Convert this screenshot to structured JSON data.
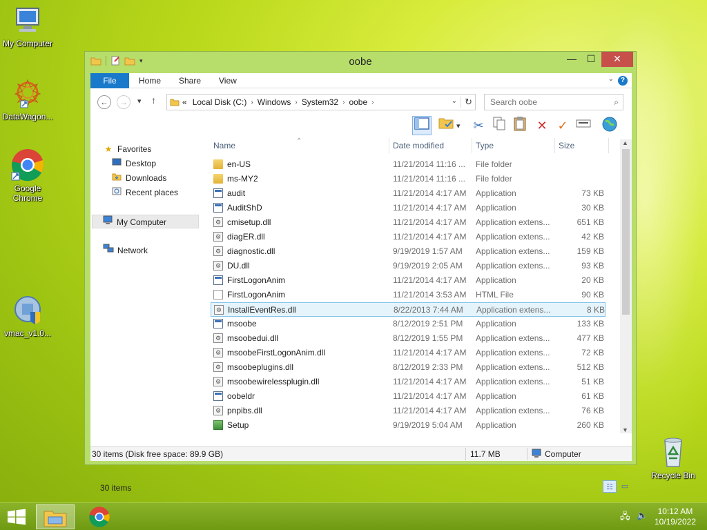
{
  "desktop": {
    "icons": [
      {
        "label": "My Computer",
        "icon": "computer-icon"
      },
      {
        "label": "DataWagon...",
        "icon": "datawagon-shortcut-icon"
      },
      {
        "label": "Google Chrome",
        "icon": "chrome-shortcut-icon"
      },
      {
        "label": "vmac_v1.0...",
        "icon": "vmac-shield-icon"
      },
      {
        "label": "Recycle Bin",
        "icon": "recycle-bin-icon"
      }
    ]
  },
  "window": {
    "title": "oobe",
    "controls": {
      "minimize": "—",
      "maximize": "☐",
      "close": "✕"
    },
    "ribbon_tabs": [
      "File",
      "Home",
      "Share",
      "View"
    ],
    "help": "?",
    "address": {
      "overflow": "«",
      "crumbs": [
        "Local Disk (C:)",
        "Windows",
        "System32",
        "oobe"
      ]
    },
    "search": {
      "placeholder": "Search oobe"
    },
    "toolbar_icons": [
      "details-pane-icon",
      "properties-folder-icon",
      "cut-icon",
      "copy-icon",
      "paste-icon",
      "delete-icon",
      "rename-icon",
      "select-icon",
      "globe-icon"
    ],
    "nav": {
      "favorites": "Favorites",
      "desktop": "Desktop",
      "downloads": "Downloads",
      "recent": "Recent places",
      "computer": "My Computer",
      "network": "Network"
    },
    "columns": {
      "name": "Name",
      "date": "Date modified",
      "type": "Type",
      "size": "Size"
    },
    "files": [
      {
        "name": "en-US",
        "date": "11/21/2014 11:16 ...",
        "type": "File folder",
        "size": "",
        "kind": "folder"
      },
      {
        "name": "ms-MY2",
        "date": "11/21/2014 11:16 ...",
        "type": "File folder",
        "size": "",
        "kind": "folder"
      },
      {
        "name": "audit",
        "date": "11/21/2014 4:17 AM",
        "type": "Application",
        "size": "73 KB",
        "kind": "app"
      },
      {
        "name": "AuditShD",
        "date": "11/21/2014 4:17 AM",
        "type": "Application",
        "size": "30 KB",
        "kind": "app"
      },
      {
        "name": "cmisetup.dll",
        "date": "11/21/2014 4:17 AM",
        "type": "Application extens...",
        "size": "651 KB",
        "kind": "dll"
      },
      {
        "name": "diagER.dll",
        "date": "11/21/2014 4:17 AM",
        "type": "Application extens...",
        "size": "42 KB",
        "kind": "dll"
      },
      {
        "name": "diagnostic.dll",
        "date": "9/19/2019 1:57 AM",
        "type": "Application extens...",
        "size": "159 KB",
        "kind": "dll"
      },
      {
        "name": "DU.dll",
        "date": "9/19/2019 2:05 AM",
        "type": "Application extens...",
        "size": "93 KB",
        "kind": "dll"
      },
      {
        "name": "FirstLogonAnim",
        "date": "11/21/2014 4:17 AM",
        "type": "Application",
        "size": "20 KB",
        "kind": "app"
      },
      {
        "name": "FirstLogonAnim",
        "date": "11/21/2014 3:53 AM",
        "type": "HTML File",
        "size": "90 KB",
        "kind": "html"
      },
      {
        "name": "InstallEventRes.dll",
        "date": "8/22/2013 7:44 AM",
        "type": "Application extens...",
        "size": "8 KB",
        "kind": "dll",
        "selected": true
      },
      {
        "name": "msoobe",
        "date": "8/12/2019 2:51 PM",
        "type": "Application",
        "size": "133 KB",
        "kind": "app"
      },
      {
        "name": "msoobedui.dll",
        "date": "8/12/2019 1:55 PM",
        "type": "Application extens...",
        "size": "477 KB",
        "kind": "dll"
      },
      {
        "name": "msoobeFirstLogonAnim.dll",
        "date": "11/21/2014 4:17 AM",
        "type": "Application extens...",
        "size": "72 KB",
        "kind": "dll"
      },
      {
        "name": "msoobeplugins.dll",
        "date": "8/12/2019 2:33 PM",
        "type": "Application extens...",
        "size": "512 KB",
        "kind": "dll"
      },
      {
        "name": "msoobewirelessplugin.dll",
        "date": "11/21/2014 4:17 AM",
        "type": "Application extens...",
        "size": "51 KB",
        "kind": "dll"
      },
      {
        "name": "oobeldr",
        "date": "11/21/2014 4:17 AM",
        "type": "Application",
        "size": "61 KB",
        "kind": "app"
      },
      {
        "name": "pnpibs.dll",
        "date": "11/21/2014 4:17 AM",
        "type": "Application extens...",
        "size": "76 KB",
        "kind": "dll"
      },
      {
        "name": "Setup",
        "date": "9/19/2019 5:04 AM",
        "type": "Application",
        "size": "260 KB",
        "kind": "setup"
      }
    ],
    "item_count": "30 items",
    "status": {
      "left": "30 items (Disk free space: 89.9 GB)",
      "size": "11.7 MB",
      "location": "Computer"
    }
  },
  "taskbar": {
    "clock_time": "10:12 AM",
    "clock_date": "10/19/2022",
    "pinned": [
      "file-explorer-icon",
      "chrome-icon"
    ]
  },
  "colors": {
    "accent": "#1979ca",
    "window_frame": "#b7dd6a",
    "selection_fill": "#e5f3fb",
    "selection_border": "#82c4ea",
    "close_button": "#c7504b"
  }
}
